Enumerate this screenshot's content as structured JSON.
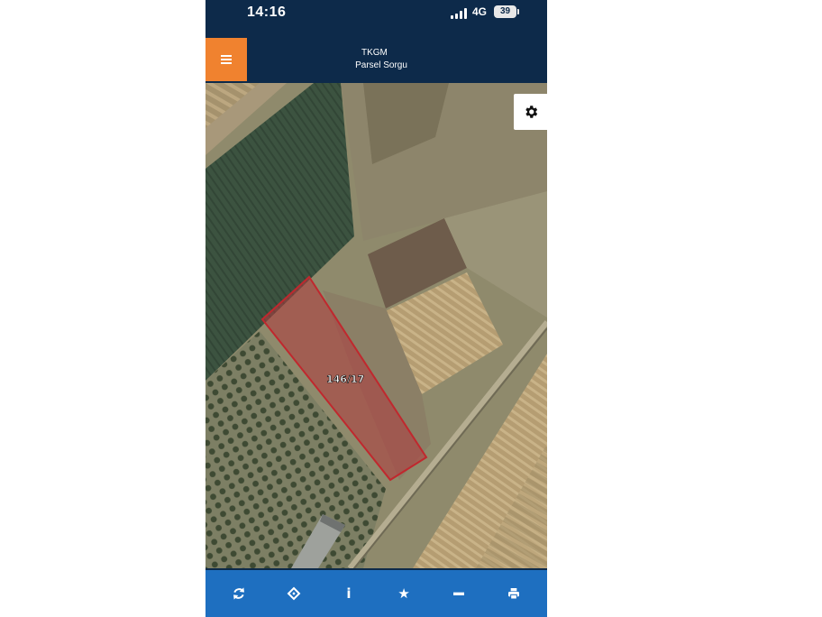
{
  "status_bar": {
    "time": "14:16",
    "network": "4G",
    "battery": "39"
  },
  "header": {
    "title": "TKGM",
    "subtitle": "Parsel Sorgu",
    "menu_icon": "hamburger-menu-icon"
  },
  "map": {
    "settings_icon": "gear-icon",
    "parcel_label": "146/17",
    "parcel_color": "#c0282e"
  },
  "toolbar": {
    "items": [
      {
        "icon": "refresh-icon"
      },
      {
        "icon": "locate-icon"
      },
      {
        "icon": "info-icon",
        "glyph": "i"
      },
      {
        "icon": "star-icon",
        "glyph": "★"
      },
      {
        "icon": "measure-icon"
      },
      {
        "icon": "print-icon"
      }
    ],
    "color": "#1e6fc0"
  },
  "colors": {
    "header_bg": "#0d2a4a",
    "menu_button": "#f0822f"
  }
}
